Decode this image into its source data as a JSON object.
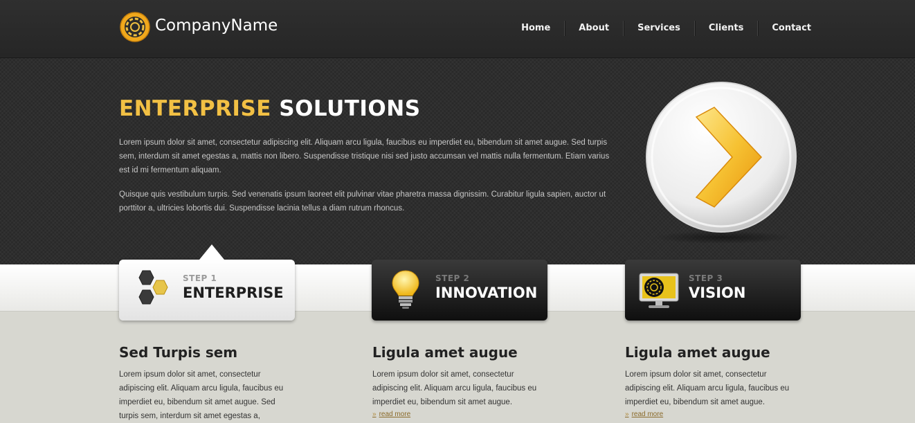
{
  "header": {
    "brand": "CompanyName",
    "nav": [
      "Home",
      "About",
      "Services",
      "Clients",
      "Contact"
    ]
  },
  "hero": {
    "title_highlight": "ENTERPRISE",
    "title_rest": "SOLUTIONS",
    "paragraph1": "Lorem ipsum dolor sit amet, consectetur adipiscing elit. Aliquam arcu ligula, faucibus eu imperdiet eu, bibendum sit amet augue. Sed turpis sem, interdum sit amet egestas a, mattis non libero. Suspendisse tristique nisi sed justo accumsan vel mattis nulla fermentum. Etiam varius est id mi fermentum aliquam.",
    "paragraph2": "Quisque quis vestibulum turpis. Sed venenatis ipsum laoreet elit pulvinar vitae pharetra massa dignissim. Curabitur ligula sapien, auctor ut porttitor a, ultricies lobortis dui. Suspendisse lacinia tellus a diam rutrum rhoncus."
  },
  "steps": [
    {
      "label": "STEP 1",
      "title": "ENTERPRISE",
      "icon": "hexagons-icon",
      "active": true
    },
    {
      "label": "STEP 2",
      "title": "INNOVATION",
      "icon": "lightbulb-icon",
      "active": false
    },
    {
      "label": "STEP 3",
      "title": "VISION",
      "icon": "monitor-icon",
      "active": false
    }
  ],
  "columns": [
    {
      "title": "Sed Turpis sem",
      "text": "Lorem ipsum dolor sit amet, consectetur adipiscing elit. Aliquam arcu ligula, faucibus eu imperdiet eu, bibendum sit amet augue. Sed turpis sem, interdum sit amet egestas a,",
      "read_more": ""
    },
    {
      "title": "Ligula amet augue",
      "text": "Lorem ipsum dolor sit amet, consectetur adipiscing elit. Aliquam arcu ligula, faucibus eu imperdiet eu, bibendum sit amet augue.",
      "read_more": "read more"
    },
    {
      "title": "Ligula amet augue",
      "text": "Lorem ipsum dolor sit amet, consectetur adipiscing elit. Aliquam arcu ligula, faucibus eu imperdiet eu, bibendum sit amet augue.",
      "read_more": "read more"
    }
  ],
  "colors": {
    "accent": "#f2c044",
    "header_bg": "#2b2b2b",
    "body_bg": "#d7d7d0"
  }
}
